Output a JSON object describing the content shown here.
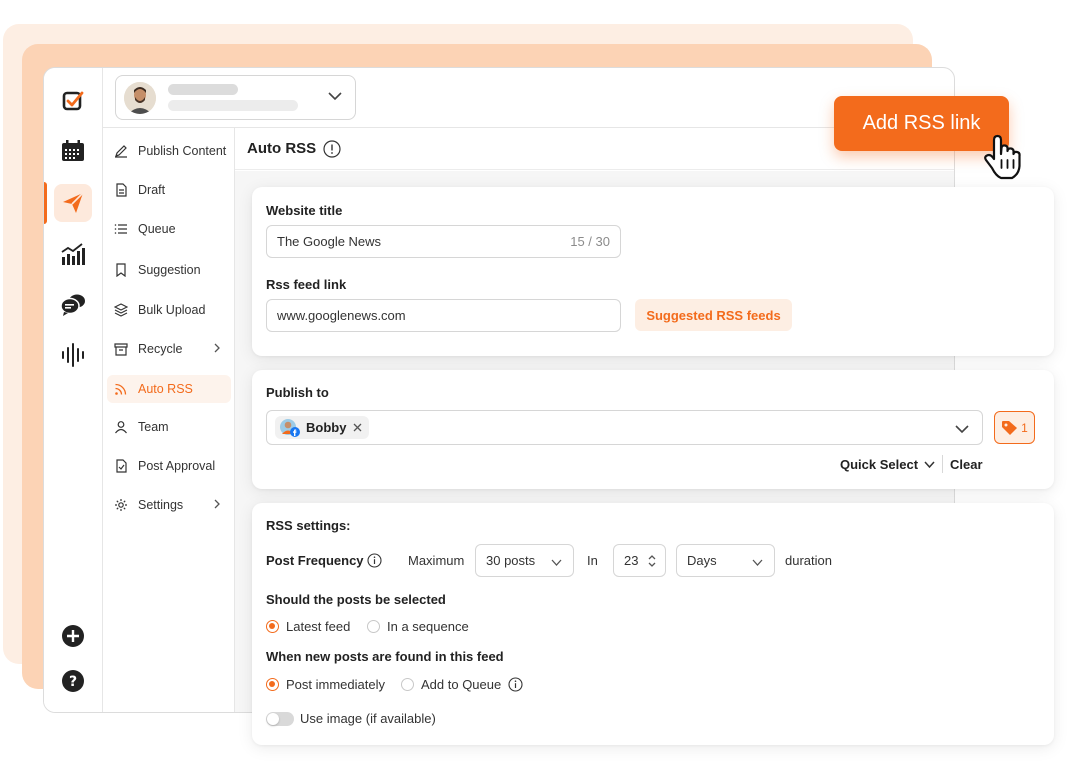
{
  "page": {
    "title": "Auto RSS",
    "cta_label": "Add RSS link"
  },
  "colors": {
    "accent": "#f36b1c",
    "accent_soft": "#fdeee3"
  },
  "rail": {
    "icons": [
      "brand-logo-icon",
      "calendar-icon",
      "send-icon",
      "analytics-icon",
      "chat-icon",
      "audio-wave-icon",
      "plus-circle-icon",
      "help-icon"
    ],
    "active": "send-icon"
  },
  "submenu": {
    "items": [
      {
        "label": "Publish Content",
        "icon": "pen-icon"
      },
      {
        "label": "Draft",
        "icon": "document-icon"
      },
      {
        "label": "Queue",
        "icon": "list-icon"
      },
      {
        "label": "Suggestion",
        "icon": "bookmark-icon"
      },
      {
        "label": "Bulk Upload",
        "icon": "layers-icon"
      },
      {
        "label": "Recycle",
        "icon": "archive-icon"
      },
      {
        "label": "Auto RSS",
        "icon": "rss-icon"
      },
      {
        "label": "Team",
        "icon": "user-icon"
      },
      {
        "label": "Post Approval",
        "icon": "approval-icon"
      },
      {
        "label": "Settings",
        "icon": "gear-icon"
      }
    ],
    "active": "Auto RSS"
  },
  "website": {
    "title_label": "Website title",
    "title_value": "The Google News",
    "title_counter": "15 / 30",
    "feed_label": "Rss feed link",
    "feed_value": "www.googlenews.com",
    "suggested_label": "Suggested RSS feeds"
  },
  "publish": {
    "label": "Publish to",
    "chip": "Bobby",
    "tag_count": "1",
    "quick_select": "Quick Select",
    "clear": "Clear"
  },
  "rss": {
    "heading": "RSS settings:",
    "frequency_label": "Post Frequency",
    "maximum": "Maximum",
    "posts_value": "30 posts",
    "in": "In",
    "number": "23",
    "unit": "Days",
    "duration": "duration",
    "selection_heading": "Should the posts be selected",
    "selection_options": [
      "Latest feed",
      "In a sequence"
    ],
    "found_heading": "When new posts are found in this feed",
    "found_options": [
      "Post immediately",
      "Add to Queue"
    ],
    "use_image": "Use image (if available)"
  }
}
